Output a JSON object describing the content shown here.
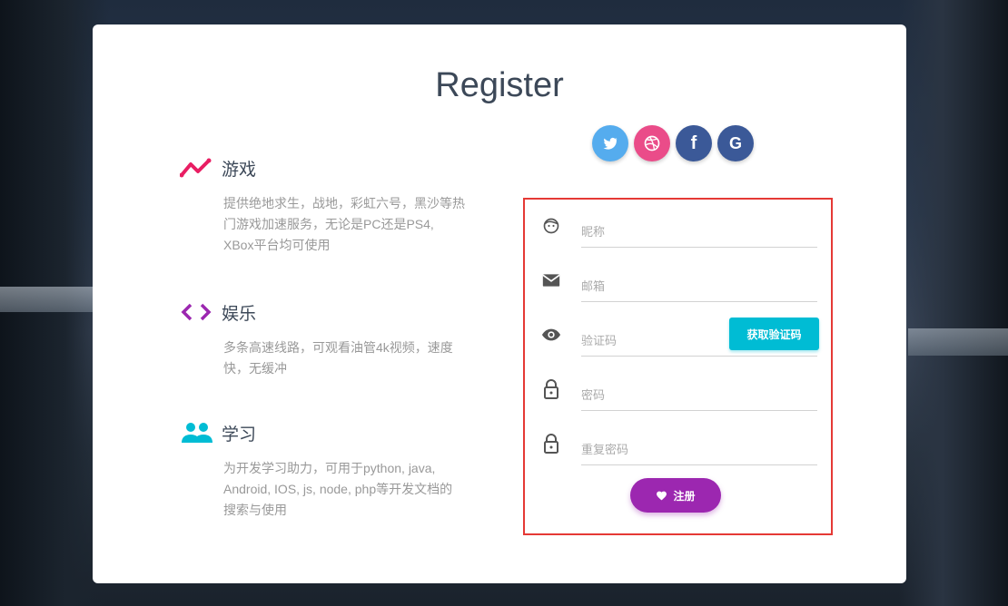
{
  "card": {
    "title": "Register"
  },
  "social": [
    {
      "name": "twitter",
      "glyph": "🐦",
      "color": "#55acee"
    },
    {
      "name": "dribbble",
      "glyph": "◎",
      "color": "#ea4c89"
    },
    {
      "name": "facebook",
      "glyph": "f",
      "color": "#3b5998"
    },
    {
      "name": "google",
      "glyph": "G",
      "color": "#3b5998"
    }
  ],
  "features": [
    {
      "title": "游戏",
      "desc": "提供绝地求生，战地，彩虹六号，黑沙等热门游戏加速服务，无论是PC还是PS4, XBox平台均可使用",
      "icon": "timeline-icon",
      "color": "#e91e63"
    },
    {
      "title": "娱乐",
      "desc": "多条高速线路，可观看油管4k视频，速度快，无缓冲",
      "icon": "code-icon",
      "color": "#9c27b0"
    },
    {
      "title": "学习",
      "desc": "为开发学习助力，可用于python, java, Android, IOS, js, node, php等开发文档的搜索与使用",
      "icon": "group-icon",
      "color": "#00bcd4"
    }
  ],
  "form": {
    "nickname_placeholder": "昵称",
    "email_placeholder": "邮箱",
    "code_placeholder": "验证码",
    "get_code_label": "获取验证码",
    "password_placeholder": "密码",
    "confirm_password_placeholder": "重复密码",
    "register_label": "注册"
  }
}
